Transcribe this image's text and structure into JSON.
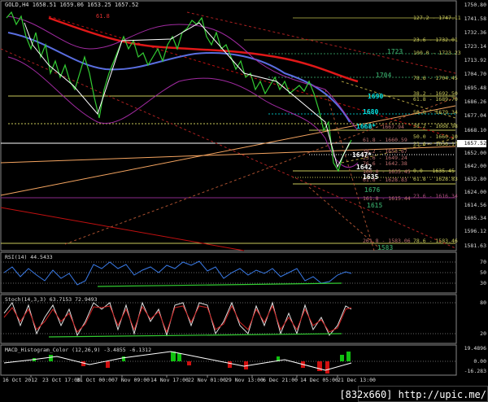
{
  "chart_header": {
    "symbol_text": "GOLD,H4",
    "ohlc_text": "1658.51 1659.06 1653.25 1657.52",
    "fib_marker": "61.8"
  },
  "price_axis": [
    "1750.80",
    "1741.58",
    "1732.36",
    "1723.14",
    "1713.92",
    "1704.70",
    "1695.48",
    "1686.26",
    "1677.04",
    "1668.10",
    "1657.52",
    "1652.00",
    "1642.00",
    "1632.80",
    "1624.00",
    "1614.56",
    "1605.34",
    "1596.12",
    "1581.63"
  ],
  "time_axis": [
    "16 Oct 2012",
    "23 Oct 17:00",
    "31 Oct 00:00",
    "7 Nov 09:00",
    "14 Nov 17:00",
    "22 Nov 01:00",
    "29 Nov 13:00",
    "6 Dec 21:00",
    "14 Dec 05:00",
    "21 Dec 13:00"
  ],
  "fib_levels": [
    {
      "text": "127.2 - 1747.11",
      "color": "#c8c85a"
    },
    {
      "text": "23.6 - 1732.01",
      "color": "#c8c85a"
    },
    {
      "text": "100.0 - 1723.23",
      "color": "#c8c85a"
    },
    {
      "text": "78.6 - 1704.45",
      "color": "#c8c85a"
    },
    {
      "text": "38.2 - 1692.50",
      "color": "#c8c85a"
    },
    {
      "text": "61.8 - 1689.70",
      "color": "#c8c85a"
    },
    {
      "text": "50.0 - 1679.34",
      "color": "#c8c85a"
    },
    {
      "text": "38.2 - 1668.98",
      "color": "#c8c85a"
    },
    {
      "text": "50.0 - 1660.10",
      "color": "#c8c85a"
    },
    {
      "text": "23.6 - 1656.17",
      "color": "#c8c85a"
    },
    {
      "text": "0.0 - 1635.45",
      "color": "#c8c85a"
    },
    {
      "text": "61.8 - 1628.83",
      "color": "#c8c85a"
    },
    {
      "text": "23.6 - 1616.34",
      "color": "#b05080"
    },
    {
      "text": "78.6 - 1583.46",
      "color": "#c8c85a"
    }
  ],
  "inner_fib_labels": [
    "0.0 - 1667.94",
    "61.8 - 1660.59",
    "38.2 - 1653.67",
    "23.6 - 1649.24",
    "76.6 - 1642.38",
    "100.0 - 1635.45",
    "61.8 - 1628.83",
    "161.8 - 1615.44",
    "261.8 - 1583.06"
  ],
  "price_marks": [
    {
      "text": "1723",
      "color": "#2e8b57"
    },
    {
      "text": "1704",
      "color": "#2e8b57"
    },
    {
      "text": "1690",
      "color": "#00e0e0"
    },
    {
      "text": "1680",
      "color": "#00e0e0"
    },
    {
      "text": "1668*",
      "color": "#00e0e0"
    },
    {
      "text": "1647*",
      "color": "#ffffff"
    },
    {
      "text": "1642",
      "color": "#ffffff"
    },
    {
      "text": "1635",
      "color": "#ffffff"
    },
    {
      "text": "1676",
      "color": "#2e8b57"
    },
    {
      "text": "1615",
      "color": "#2e8b57"
    },
    {
      "text": "1583",
      "color": "#2e8b57"
    }
  ],
  "rsi": {
    "title": "RSI(14) 44.5433",
    "levels": [
      "70",
      "50",
      "30"
    ]
  },
  "stoch": {
    "title": "Stoch(14,3,3) 63.7153 72.9493",
    "levels": [
      "80",
      "20"
    ]
  },
  "macd": {
    "title": "MACD_Histogram_Color (12,26,9) -3.4855 -6.1312",
    "levels": [
      "19.4896",
      "0.00",
      "-16.283"
    ]
  },
  "watermark": "[832x660] http://upic.me/"
}
